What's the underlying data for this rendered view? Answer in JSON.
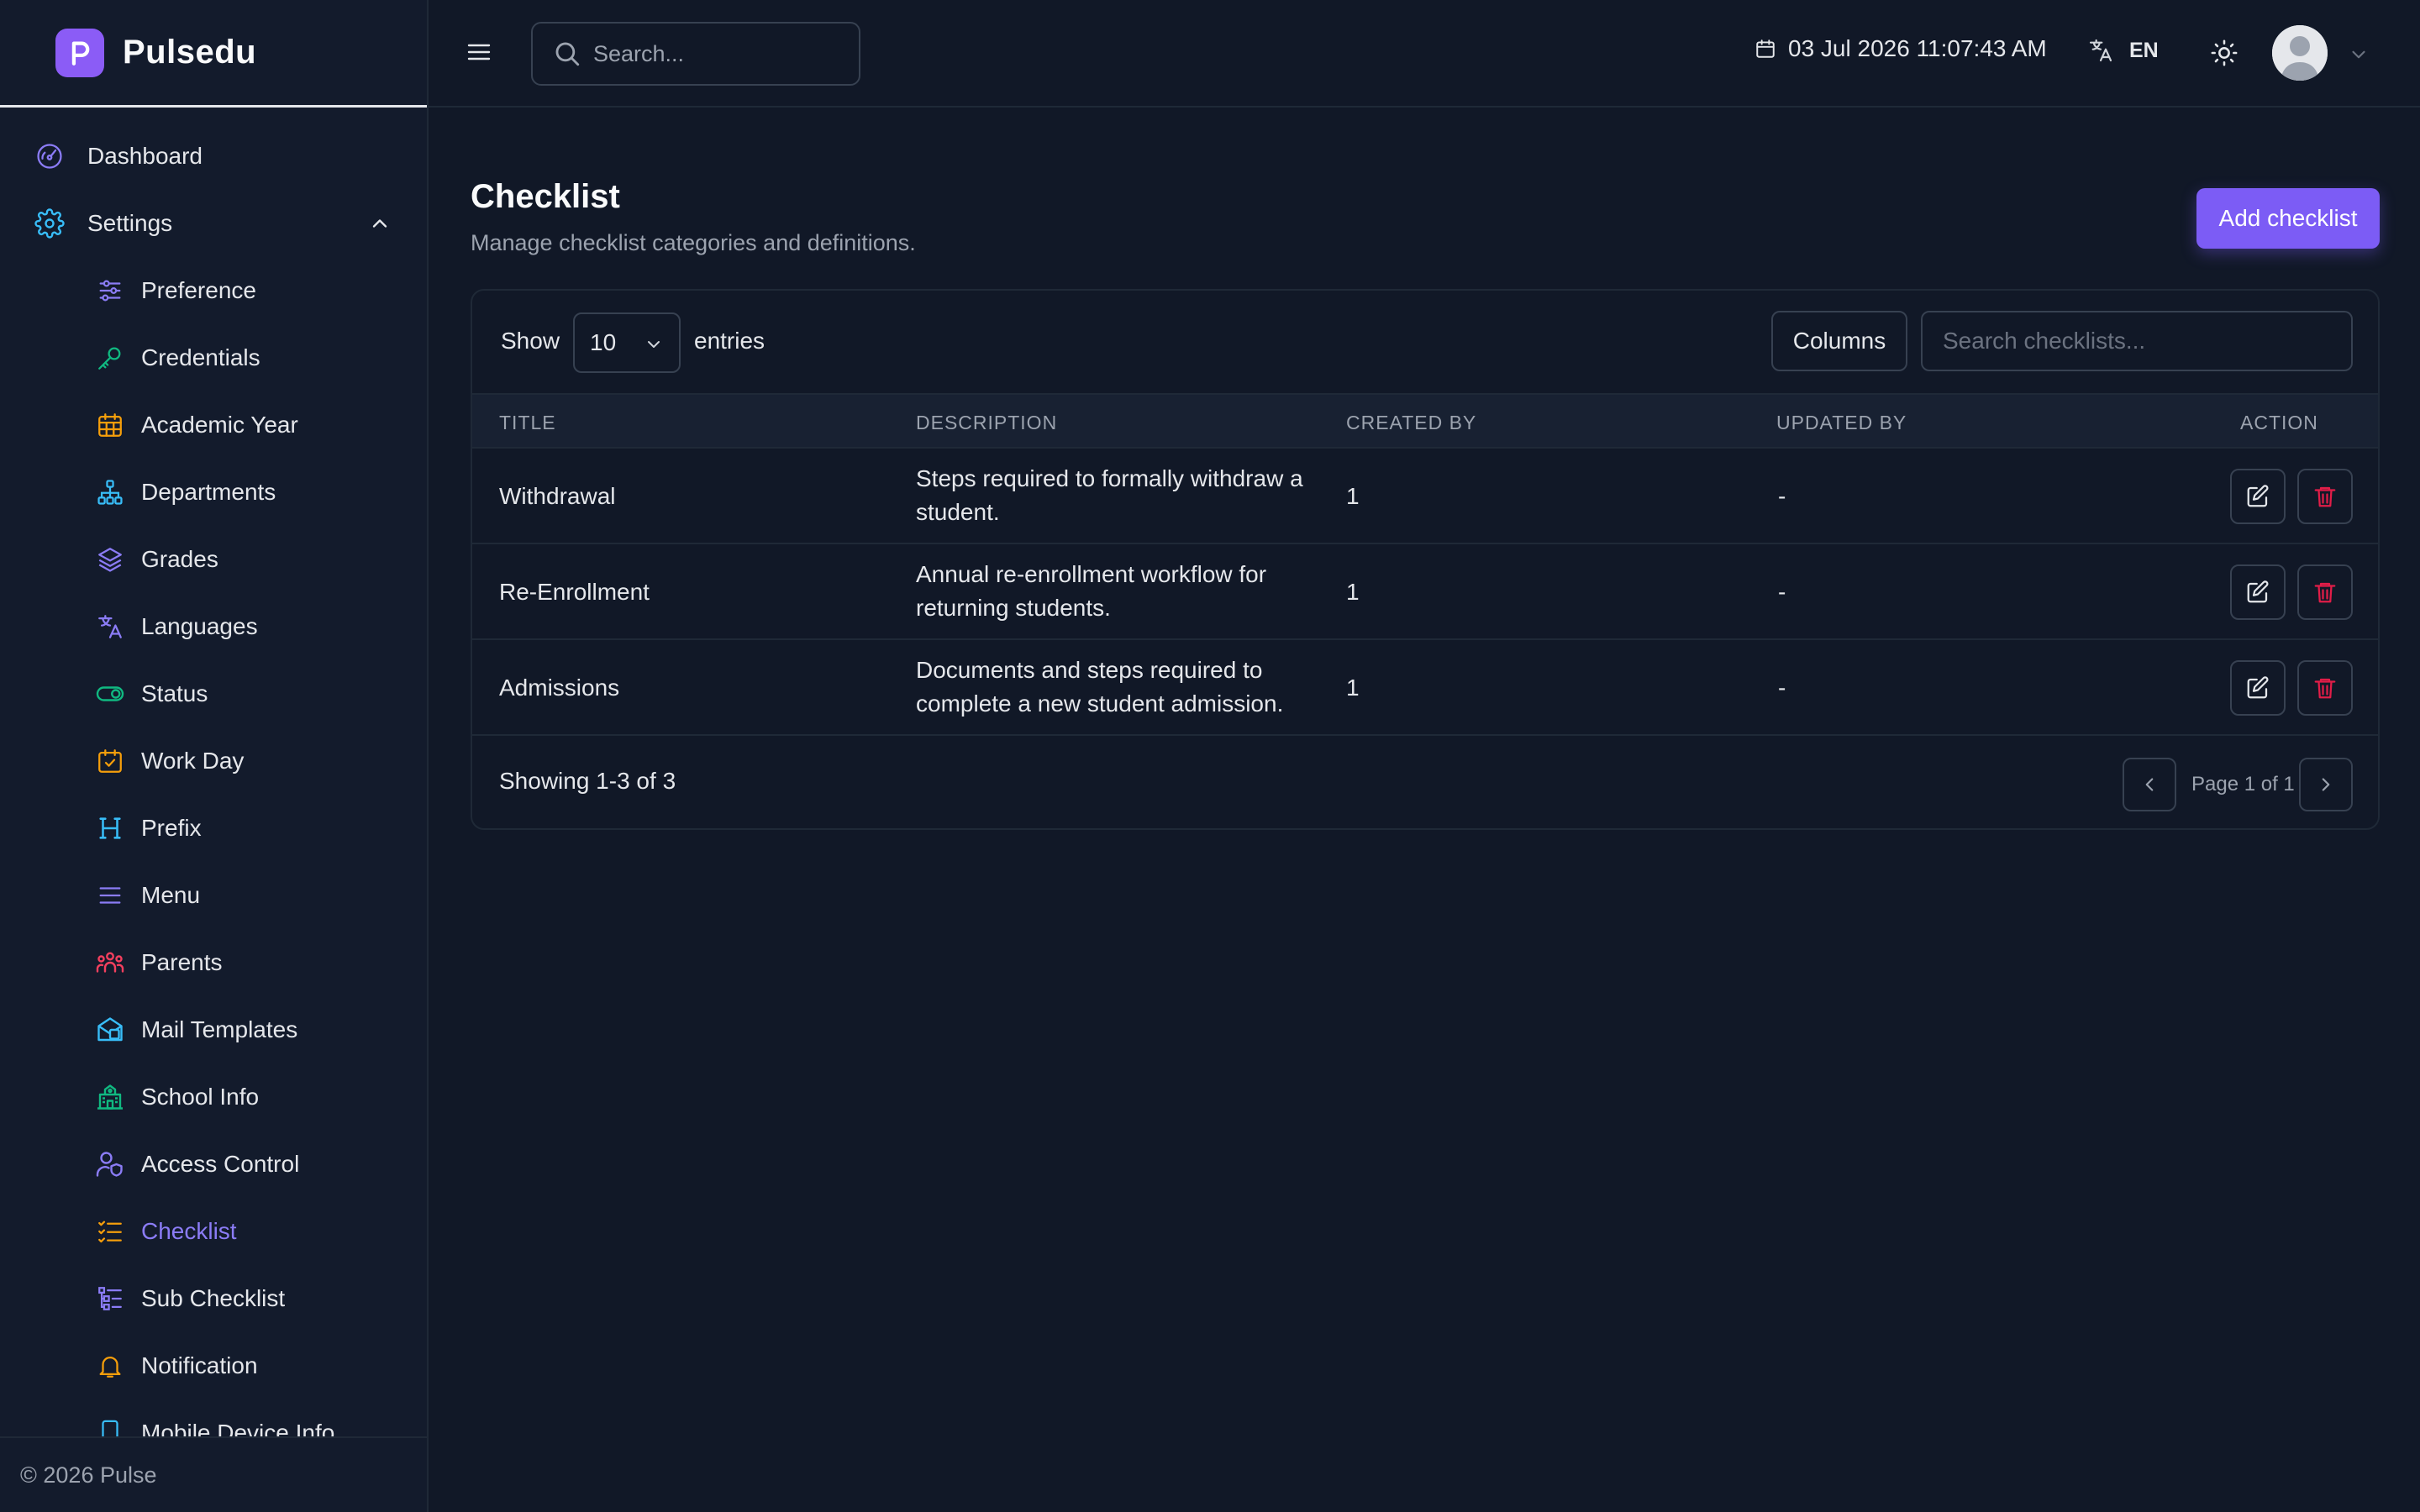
{
  "brand": {
    "name": "Pulsedu",
    "logo_icon": "pulse-p-logo",
    "accent": "#8b5cf6"
  },
  "sidebar": {
    "top_items": [
      {
        "label": "Dashboard",
        "icon": "dashboard-gauge-icon"
      },
      {
        "label": "Settings",
        "icon": "gear-icon",
        "expanded": true
      }
    ],
    "sub_items": [
      {
        "label": "Preference",
        "icon": "sliders-icon",
        "color": "#8b7cf6"
      },
      {
        "label": "Credentials",
        "icon": "key-icon",
        "color": "#10b981"
      },
      {
        "label": "Academic Year",
        "icon": "calendar-grid-icon",
        "color": "#f59e0b"
      },
      {
        "label": "Departments",
        "icon": "hierarchy-icon",
        "color": "#38bdf8"
      },
      {
        "label": "Grades",
        "icon": "layers-icon",
        "color": "#8b7cf6"
      },
      {
        "label": "Languages",
        "icon": "translate-icon",
        "color": "#8b7cf6"
      },
      {
        "label": "Status",
        "icon": "toggle-icon",
        "color": "#10b981"
      },
      {
        "label": "Work Day",
        "icon": "calendar-check-icon",
        "color": "#f59e0b"
      },
      {
        "label": "Prefix",
        "icon": "heading-icon",
        "color": "#38bdf8"
      },
      {
        "label": "Menu",
        "icon": "menu-lines-icon",
        "color": "#8b7cf6"
      },
      {
        "label": "Parents",
        "icon": "family-icon",
        "color": "#f43f5e"
      },
      {
        "label": "Mail Templates",
        "icon": "mail-template-icon",
        "color": "#38bdf8"
      },
      {
        "label": "School Info",
        "icon": "school-icon",
        "color": "#10b981"
      },
      {
        "label": "Access Control",
        "icon": "user-shield-icon",
        "color": "#8b7cf6"
      },
      {
        "label": "Checklist",
        "icon": "checklist-icon",
        "color": "#f59e0b",
        "active": true
      },
      {
        "label": "Sub Checklist",
        "icon": "sub-checklist-icon",
        "color": "#8b7cf6"
      },
      {
        "label": "Notification",
        "icon": "bell-icon",
        "color": "#f59e0b"
      },
      {
        "label": "Mobile Device Info",
        "icon": "mobile-icon",
        "color": "#38bdf8"
      }
    ],
    "footer": "© 2026 Pulse"
  },
  "topbar": {
    "search_placeholder": "Search...",
    "datetime": "03 Jul 2026 11:07:43 AM",
    "language": "EN"
  },
  "page": {
    "title": "Checklist",
    "subtitle": "Manage checklist categories and definitions.",
    "add_button": "Add checklist"
  },
  "table": {
    "show_label": "Show",
    "entries_value": "10",
    "entries_label": "entries",
    "columns_button": "Columns",
    "search_placeholder": "Search checklists...",
    "headers": {
      "title": "Title",
      "description": "Description",
      "created_by": "Created By",
      "updated_by": "Updated By",
      "action": "Action"
    },
    "rows": [
      {
        "title": "Withdrawal",
        "description": "Steps required to formally withdraw a student.",
        "created_by": "1",
        "updated_by": "-"
      },
      {
        "title": "Re-Enrollment",
        "description": "Annual re-enrollment workflow for returning students.",
        "created_by": "1",
        "updated_by": "-"
      },
      {
        "title": "Admissions",
        "description": "Documents and steps required to complete a new student admission.",
        "created_by": "1",
        "updated_by": "-"
      }
    ],
    "showing": "Showing 1-3 of 3",
    "page_label": "Page 1 of 1",
    "delete_color": "#e11d48"
  }
}
